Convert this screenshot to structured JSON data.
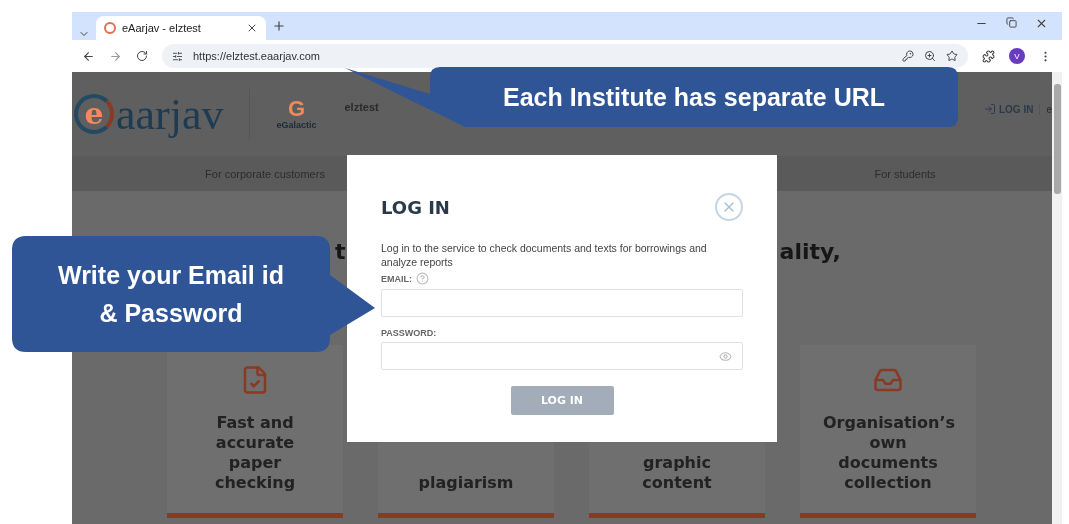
{
  "browser": {
    "tab": {
      "title": "eAarjav - elztest",
      "selected": true
    },
    "url": "https://elztest.eaarjav.com",
    "profile_initial": "V"
  },
  "header": {
    "logo": {
      "mark": "e",
      "text": "aarjav"
    },
    "partner": {
      "mark": "G",
      "name": "eGalactic"
    },
    "institute": "elztest",
    "login": "LOG IN",
    "cut_link": "e"
  },
  "nav": [
    "For corporate customers",
    "For students"
  ],
  "headline_parts": [
    "t",
    "ality,"
  ],
  "cards": [
    {
      "kind": "document",
      "title": "Fast and accurate paper checking"
    },
    {
      "kind": "plain",
      "title": "plagiarism"
    },
    {
      "kind": "plain",
      "title": "graphic content"
    },
    {
      "kind": "tray",
      "title": "Organisation’s own documents collection"
    }
  ],
  "modal": {
    "title": "LOG IN",
    "description": "Log in to the service to check documents and texts for borrowings and analyze reports",
    "email_label": "EMAIL:",
    "password_label": "PASSWORD:",
    "submit": {
      "label": "LOG IN",
      "disabled": true
    }
  },
  "callouts": [
    {
      "text": "Each Institute has separate URL"
    },
    {
      "text": "Write your Email id & Password"
    }
  ]
}
